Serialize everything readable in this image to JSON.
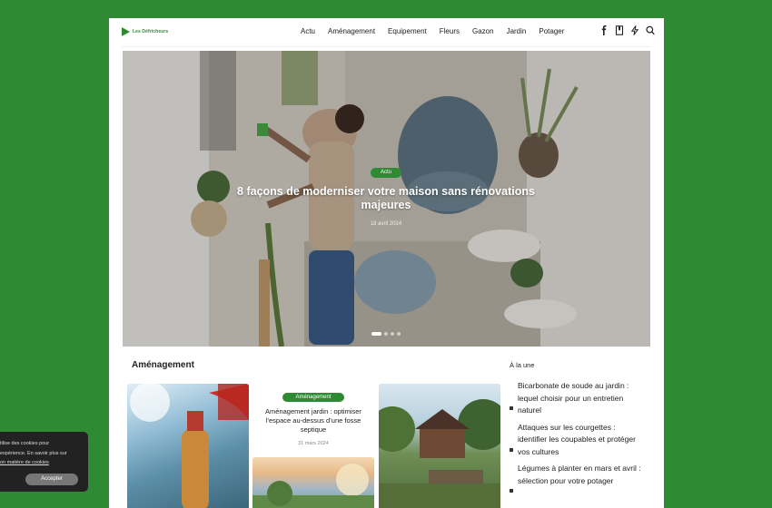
{
  "brand": {
    "name": "Les Défricheurs",
    "accent": "#2e8b34"
  },
  "nav": {
    "items": [
      "Actu",
      "Aménagement",
      "Equipement",
      "Fleurs",
      "Gazon",
      "Jardin",
      "Potager"
    ],
    "icons": [
      "facebook-icon",
      "bookmark-icon",
      "lightning-icon",
      "search-icon"
    ]
  },
  "hero": {
    "badge": "Actu",
    "title": "8 façons de moderniser votre maison sans rénovations majeures",
    "date": "18 avril 2024",
    "slides": 4,
    "active_slide": 1
  },
  "section": {
    "title": "Aménagement",
    "featured": {
      "badge": "Aménagement",
      "title": "Aménagement jardin : optimiser l’espace au-dessus d’une fosse septique",
      "date": "31 mars 2024"
    }
  },
  "sidebar": {
    "title": "À la une",
    "items": [
      "Bicarbonate de soude au jardin : lequel choisir pour un entretien naturel",
      "Attaques sur les courgettes : identifier les coupables et protéger vos cultures",
      "Légumes à planter en mars et avril : sélection pour votre potager"
    ]
  },
  "cookie": {
    "line1": "tilise des cookies pour",
    "line2": "expérience. En savoir plus sur",
    "link": "on matière de cookies",
    "button": "Accepter"
  }
}
